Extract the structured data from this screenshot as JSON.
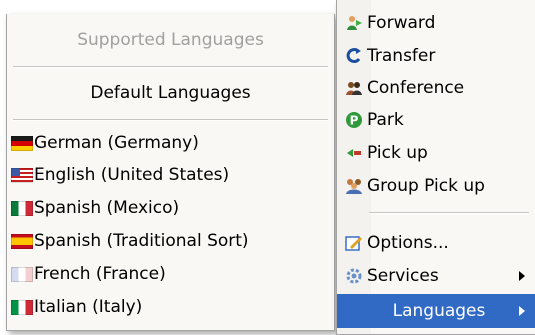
{
  "languages_menu": {
    "header": "Supported Languages",
    "default_item": "Default Languages",
    "items": [
      {
        "label": "German (Germany)",
        "flag": "flag-germany-icon"
      },
      {
        "label": "English (United States)",
        "flag": "flag-united-states-icon"
      },
      {
        "label": "Spanish (Mexico)",
        "flag": "flag-mexico-icon"
      },
      {
        "label": "Spanish (Traditional Sort)",
        "flag": "flag-spain-icon"
      },
      {
        "label": "French (France)",
        "flag": "flag-france-icon"
      },
      {
        "label": "Italian (Italy)",
        "flag": "flag-italy-icon"
      }
    ]
  },
  "main_menu": {
    "items": [
      {
        "label": "Forward",
        "icon": "forward-icon"
      },
      {
        "label": "Transfer",
        "icon": "transfer-icon"
      },
      {
        "label": "Conference",
        "icon": "conference-icon"
      },
      {
        "label": "Park",
        "icon": "park-icon"
      },
      {
        "label": "Pick up",
        "icon": "pickup-icon"
      },
      {
        "label": "Group Pick up",
        "icon": "group-pickup-icon"
      },
      {
        "label": "Options...",
        "icon": "options-icon"
      },
      {
        "label": "Services",
        "icon": "services-icon"
      },
      {
        "label": "Languages",
        "icon": ""
      }
    ],
    "selected": "Languages"
  },
  "colors": {
    "menu_background": "#f9f8f5",
    "highlight": "#316ac5",
    "disabled_text": "#a0a0a0"
  }
}
